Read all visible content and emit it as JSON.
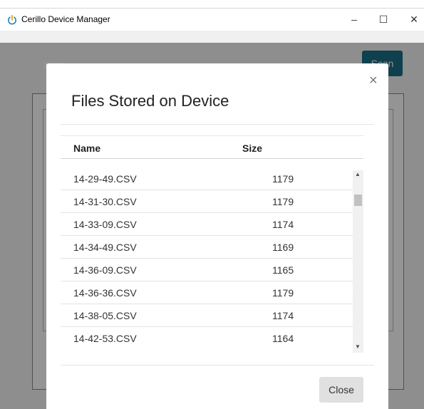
{
  "window": {
    "title": "Cerillo Device Manager",
    "icon": "power-icon",
    "accent": "#1a86c8",
    "controls": {
      "minimize": "–",
      "maximize": "☐",
      "close": "✕"
    }
  },
  "app": {
    "scan_label": "Scan",
    "scan_color": "#1a6f86"
  },
  "modal": {
    "title": "Files Stored on Device",
    "close_symbol": "×",
    "columns": {
      "name": "Name",
      "size": "Size"
    },
    "rows": [
      {
        "name": "14-29-49.CSV",
        "size": "1179"
      },
      {
        "name": "14-31-30.CSV",
        "size": "1179"
      },
      {
        "name": "14-33-09.CSV",
        "size": "1174"
      },
      {
        "name": "14-34-49.CSV",
        "size": "1169"
      },
      {
        "name": "14-36-09.CSV",
        "size": "1165"
      },
      {
        "name": "14-36-36.CSV",
        "size": "1179"
      },
      {
        "name": "14-38-05.CSV",
        "size": "1174"
      },
      {
        "name": "14-42-53.CSV",
        "size": "1164"
      }
    ],
    "close_label": "Close"
  }
}
